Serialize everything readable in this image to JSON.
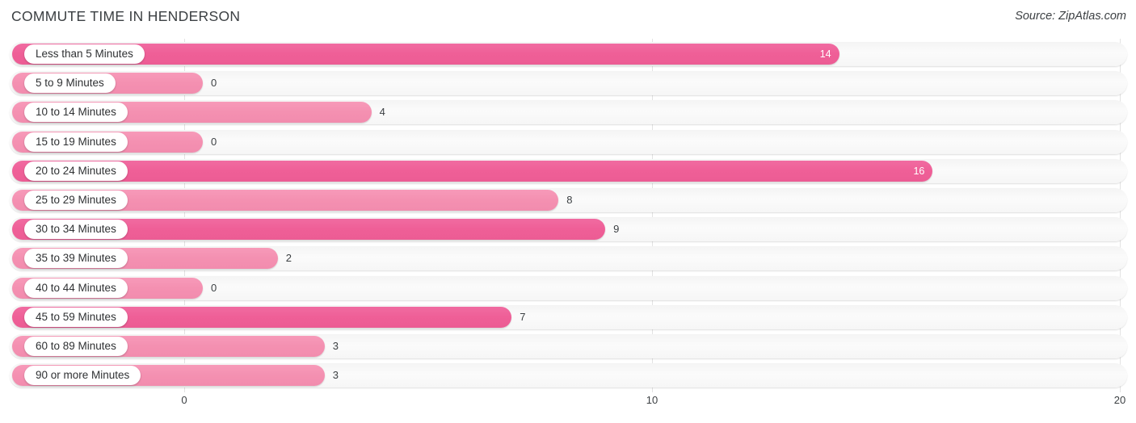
{
  "header": {
    "title": "COMMUTE TIME IN HENDERSON",
    "source": "Source: ZipAtlas.com"
  },
  "colors": {
    "bar_dark": "#ef5f97",
    "bar_light": "#f490b1",
    "track": "#f6f6f6",
    "gridline": "#e3e3e3",
    "text": "#3c4043"
  },
  "axis": {
    "ticks": [
      {
        "label": "0",
        "value": 0
      },
      {
        "label": "10",
        "value": 10
      },
      {
        "label": "20",
        "value": 20
      }
    ],
    "min": 0,
    "max": 20
  },
  "chart_data": {
    "type": "bar",
    "orientation": "horizontal",
    "title": "COMMUTE TIME IN HENDERSON",
    "subtitle": "Source: ZipAtlas.com",
    "xlabel": "",
    "ylabel": "",
    "xlim": [
      0,
      20
    ],
    "grid": true,
    "legend": false,
    "categories": [
      "Less than 5 Minutes",
      "5 to 9 Minutes",
      "10 to 14 Minutes",
      "15 to 19 Minutes",
      "20 to 24 Minutes",
      "25 to 29 Minutes",
      "30 to 34 Minutes",
      "35 to 39 Minutes",
      "40 to 44 Minutes",
      "45 to 59 Minutes",
      "60 to 89 Minutes",
      "90 or more Minutes"
    ],
    "values": [
      14,
      0,
      4,
      0,
      16,
      8,
      9,
      2,
      0,
      7,
      3,
      3
    ],
    "value_labels": [
      "14",
      "0",
      "4",
      "0",
      "16",
      "8",
      "9",
      "2",
      "0",
      "7",
      "3",
      "3"
    ]
  },
  "rows": [
    {
      "label": "Less than 5 Minutes",
      "value": 14,
      "display": "14",
      "shade": "dark",
      "label_placement": "inside"
    },
    {
      "label": "5 to 9 Minutes",
      "value": 0,
      "display": "0",
      "shade": "light",
      "label_placement": "outside"
    },
    {
      "label": "10 to 14 Minutes",
      "value": 4,
      "display": "4",
      "shade": "light",
      "label_placement": "outside"
    },
    {
      "label": "15 to 19 Minutes",
      "value": 0,
      "display": "0",
      "shade": "light",
      "label_placement": "outside"
    },
    {
      "label": "20 to 24 Minutes",
      "value": 16,
      "display": "16",
      "shade": "dark",
      "label_placement": "inside"
    },
    {
      "label": "25 to 29 Minutes",
      "value": 8,
      "display": "8",
      "shade": "light",
      "label_placement": "outside"
    },
    {
      "label": "30 to 34 Minutes",
      "value": 9,
      "display": "9",
      "shade": "dark",
      "label_placement": "outside"
    },
    {
      "label": "35 to 39 Minutes",
      "value": 2,
      "display": "2",
      "shade": "light",
      "label_placement": "outside"
    },
    {
      "label": "40 to 44 Minutes",
      "value": 0,
      "display": "0",
      "shade": "light",
      "label_placement": "outside"
    },
    {
      "label": "45 to 59 Minutes",
      "value": 7,
      "display": "7",
      "shade": "dark",
      "label_placement": "outside"
    },
    {
      "label": "60 to 89 Minutes",
      "value": 3,
      "display": "3",
      "shade": "light",
      "label_placement": "outside"
    },
    {
      "label": "90 or more Minutes",
      "value": 3,
      "display": "3",
      "shade": "light",
      "label_placement": "outside"
    }
  ]
}
